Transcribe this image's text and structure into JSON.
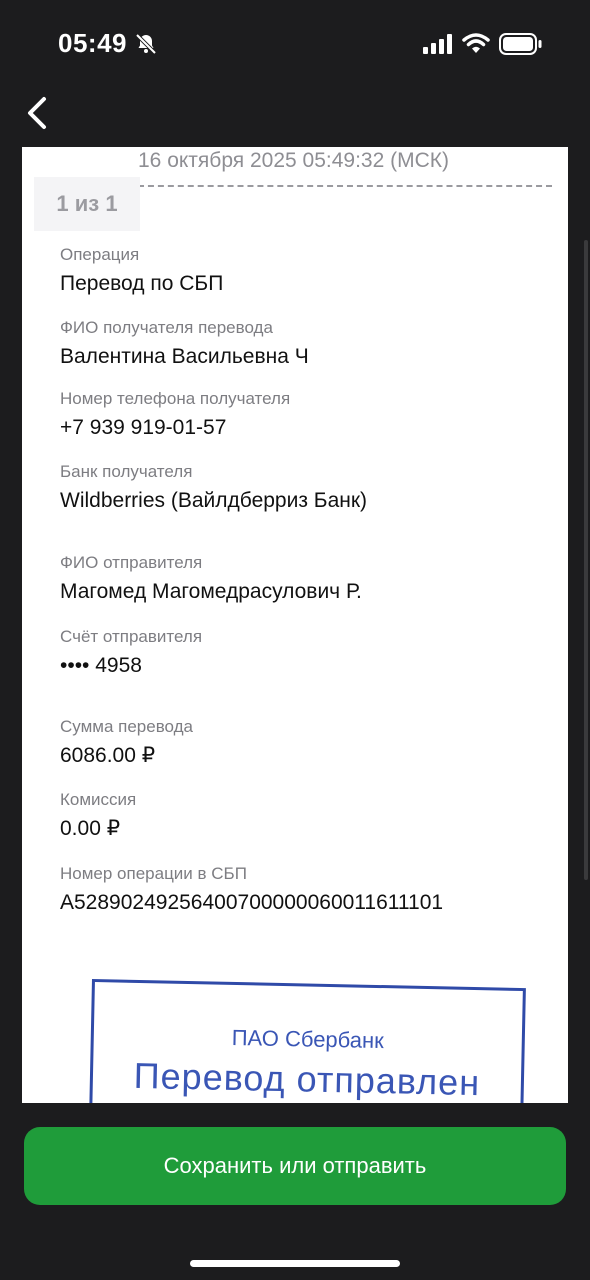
{
  "status_bar": {
    "time": "05:49",
    "icons": [
      "bell-slash-icon",
      "cellular-signal-icon",
      "wifi-icon",
      "battery-icon"
    ]
  },
  "nav": {
    "back_icon": "chevron-left-icon"
  },
  "receipt": {
    "datetime": "16 октября 2025 05:49:32 (МСК)",
    "pager": "1 из 1",
    "fields": [
      {
        "label": "Операция",
        "value": "Перевод по СБП"
      },
      {
        "label": "ФИО получателя перевода",
        "value": "Валентина Васильевна Ч"
      },
      {
        "label": "Номер телефона получателя",
        "value": "+7 939 919-01-57"
      },
      {
        "label": "Банк получателя",
        "value": "Wildberries (Вайлдберриз Банк)"
      },
      {
        "label": "ФИО отправителя",
        "value": "Магомед Магомедрасулович Р."
      },
      {
        "label": "Счёт отправителя",
        "value": "•••• 4958"
      },
      {
        "label": "Сумма перевода",
        "value": "6086.00 ₽"
      },
      {
        "label": "Комиссия",
        "value": "0.00 ₽"
      },
      {
        "label": "Номер операции в СБП",
        "value": "A52890249256400700000060011611101"
      }
    ],
    "stamp": {
      "org": "ПАО Сбербанк",
      "message": "Перевод отправлен"
    }
  },
  "actions": {
    "save_label": "Сохранить или отправить"
  },
  "colors": {
    "background": "#1c1c1e",
    "accent": "#1f9c3a",
    "stamp": "#2f4aa8"
  }
}
